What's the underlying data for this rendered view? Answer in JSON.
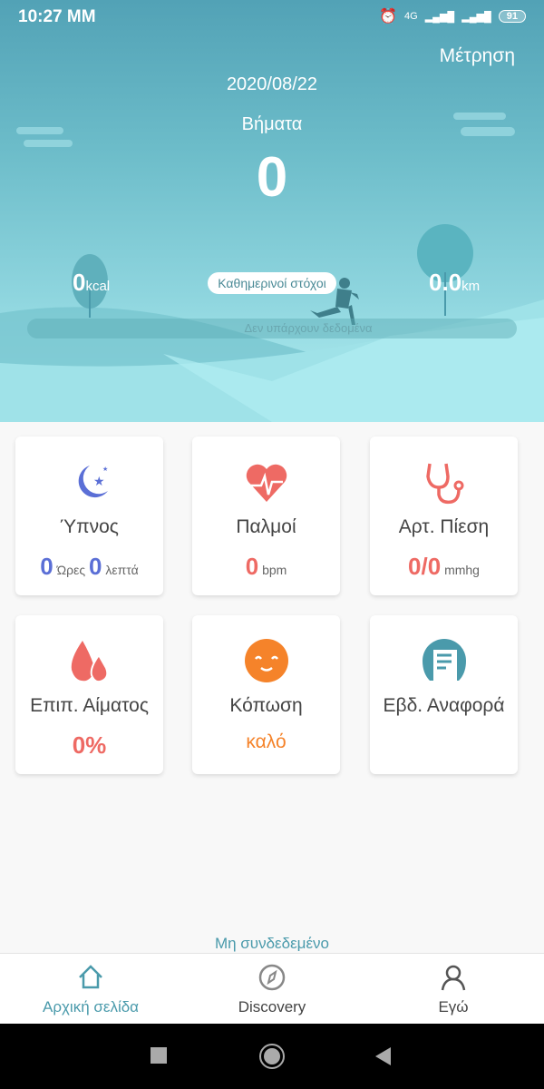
{
  "status_bar": {
    "time": "10:27 MM",
    "network": "4G",
    "battery": "91"
  },
  "header": {
    "measure_button": "Μέτρηση",
    "date": "2020/08/22",
    "steps_label": "Βήματα",
    "steps_value": "0"
  },
  "goals": {
    "kcal_value": "0",
    "kcal_unit": "kcal",
    "daily_goals_label": "Καθημερινοί στόχοι",
    "km_value": "0.0",
    "km_unit": "km",
    "no_data": "Δεν υπάρχουν δεδομένα"
  },
  "cards": [
    {
      "label": "Ύπνος",
      "hours": "0",
      "hours_unit": "Ώρες",
      "minutes": "0",
      "minutes_unit": "λεπτά",
      "icon": "moon-icon",
      "color": "#5b6fd6"
    },
    {
      "label": "Παλμοί",
      "value": "0",
      "unit": "bpm",
      "icon": "heart-rate-icon",
      "color": "#ee6a64"
    },
    {
      "label": "Αρτ. Πίεση",
      "value": "0/0",
      "unit": "mmhg",
      "icon": "stethoscope-icon",
      "color": "#ee6a64"
    },
    {
      "label": "Επιπ. Αίματος",
      "value": "0%",
      "icon": "blood-drops-icon",
      "color": "#ee6a64"
    },
    {
      "label": "Κόπωση",
      "value": "καλό",
      "icon": "smiley-icon",
      "color": "#f5832a"
    },
    {
      "label": "Εβδ. Αναφορά",
      "icon": "report-icon",
      "color": "#4a9aab"
    }
  ],
  "connection_status": "Μη συνδεδεμένο",
  "bottom_nav": [
    {
      "label": "Αρχική σελίδα",
      "icon": "home-icon",
      "active": true
    },
    {
      "label": "Discovery",
      "icon": "compass-icon"
    },
    {
      "label": "Εγώ",
      "icon": "user-icon"
    }
  ],
  "accent": "#4a9aab"
}
